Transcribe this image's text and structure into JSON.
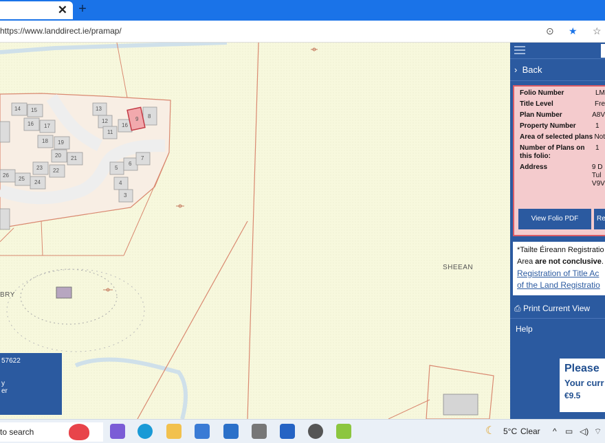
{
  "browser": {
    "tab_close": "✕",
    "new_tab": "+",
    "url": "https://www.landdirect.ie/pramap/",
    "icons": [
      "more-icon",
      "star-icon",
      "favorites-icon"
    ]
  },
  "map": {
    "plot_labels": [
      "14",
      "15",
      "16",
      "17",
      "18",
      "19",
      "20",
      "21",
      "22",
      "23",
      "24",
      "25",
      "26",
      "13",
      "12",
      "11",
      "16",
      "9",
      "8",
      "5",
      "6",
      "7",
      "4",
      "3"
    ],
    "townland": "SHEEAN",
    "partial_label": "BRY",
    "left_tip_number": "57622",
    "left_tip_lines": [
      "y",
      "er"
    ]
  },
  "panel": {
    "back": "Back",
    "folio": [
      {
        "key": "Folio Number",
        "value": "LM"
      },
      {
        "key": "Title Level",
        "value": "Fre"
      },
      {
        "key": "Plan Number",
        "value": "A8V"
      },
      {
        "key": "Property Number",
        "value": "1"
      },
      {
        "key": "Area of selected plans",
        "value": "Not"
      },
      {
        "key": "Number of Plans on this folio:",
        "value": "1"
      },
      {
        "key": "Address",
        "value": "9 D Tul V9V"
      }
    ],
    "view_pdf": "View Folio PDF",
    "re_button": "Re",
    "disclaimer_line1": "*Tailte Éireann Registratio",
    "disclaimer_line2_pre": "Area ",
    "disclaimer_line2_bold": "are not conclusive",
    "disclaimer_line2_post": ".",
    "disclaimer_link1": "Registration of Title Ac",
    "disclaimer_link2": "of the Land Registratio",
    "print": "Print Current View",
    "help": "Help",
    "promo_title": "Please",
    "promo_sub": "Your curr",
    "promo_price": "€9.5"
  },
  "taskbar": {
    "search": "to search",
    "weather": "5°C",
    "condition": "Clear",
    "chevron": "^"
  }
}
